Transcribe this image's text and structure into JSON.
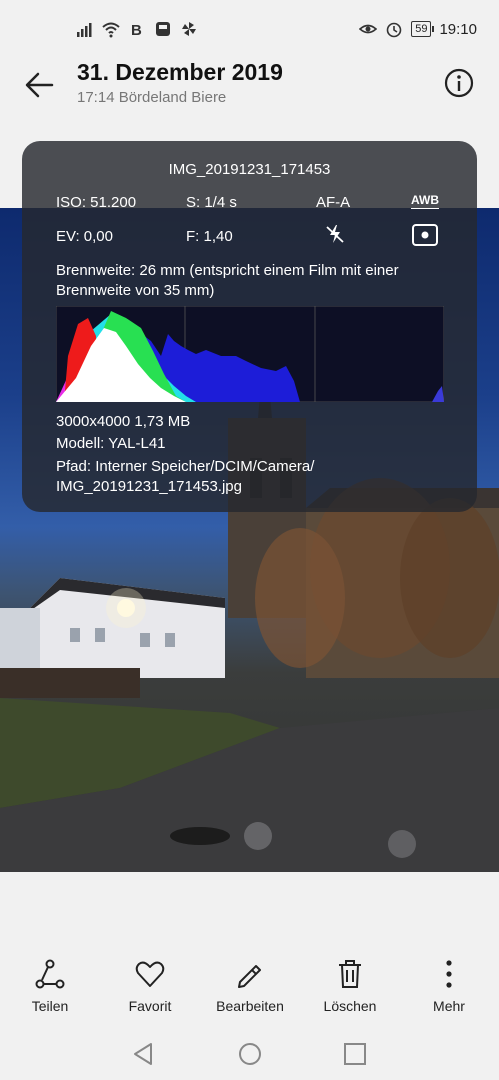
{
  "status_bar": {
    "time": "19:10",
    "battery": "59",
    "left_icons": [
      "signal-icon",
      "wifi-icon",
      "b-notification-icon",
      "app-notification-icon",
      "pinwheel-icon"
    ],
    "right_icons": [
      "eye-comfort-icon",
      "alarm-icon"
    ]
  },
  "header": {
    "title": "31. Dezember 2019",
    "subtitle": "17:14 Bördeland Biere"
  },
  "info": {
    "filename": "IMG_20191231_171453",
    "iso": "ISO: 51.200",
    "shutter": "S: 1/4 s",
    "af": "AF-A",
    "awb": "AWB",
    "ev": "EV: 0,00",
    "aperture": "F: 1,40",
    "focal": "Brennweite: 26 mm (entspricht einem Film mit einer Brennweite von 35 mm)",
    "size": "3000x4000  1,73 MB",
    "model": "Modell:  YAL-L41",
    "path": "Pfad:  Interner Speicher/DCIM/Camera/ IMG_20191231_171453.jpg"
  },
  "actions": [
    {
      "label": "Teilen",
      "icon": "share-icon"
    },
    {
      "label": "Favorit",
      "icon": "heart-icon"
    },
    {
      "label": "Bearbeiten",
      "icon": "edit-icon"
    },
    {
      "label": "Löschen",
      "icon": "trash-icon"
    },
    {
      "label": "Mehr",
      "icon": "more-icon"
    }
  ],
  "nav": [
    "back-triangle-icon",
    "home-circle-icon",
    "recents-square-icon"
  ]
}
